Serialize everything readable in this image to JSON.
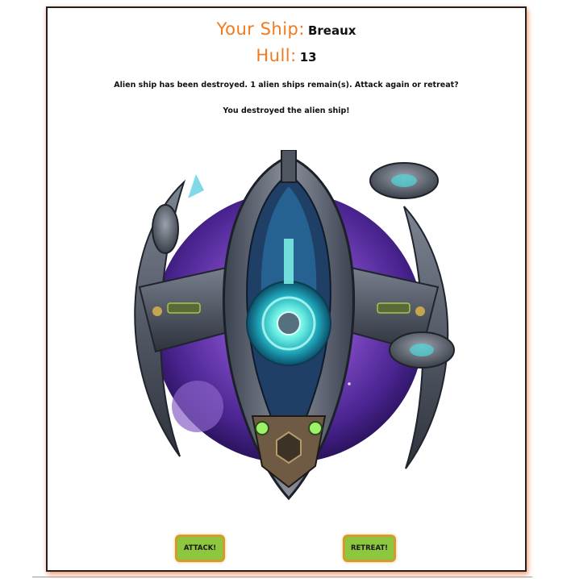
{
  "header": {
    "ship_label": "Your Ship:",
    "ship_name": "Breaux",
    "hull_label": "Hull:",
    "hull_value": "13"
  },
  "messages": {
    "status": "Alien ship has been destroyed. 1 alien ships remain(s). Attack again or retreat?",
    "result": "You destroyed the alien ship!"
  },
  "artwork": {
    "subject": "spaceship-illustration"
  },
  "buttons": {
    "attack_label": "ATTACK!",
    "retreat_label": "RETREAT!"
  },
  "colors": {
    "accent_orange": "#f07a1f",
    "button_green": "#8dc63f",
    "button_border": "#d49b2a",
    "planet_purple": "#6a3aa8",
    "core_cyan": "#3fe0d0"
  }
}
